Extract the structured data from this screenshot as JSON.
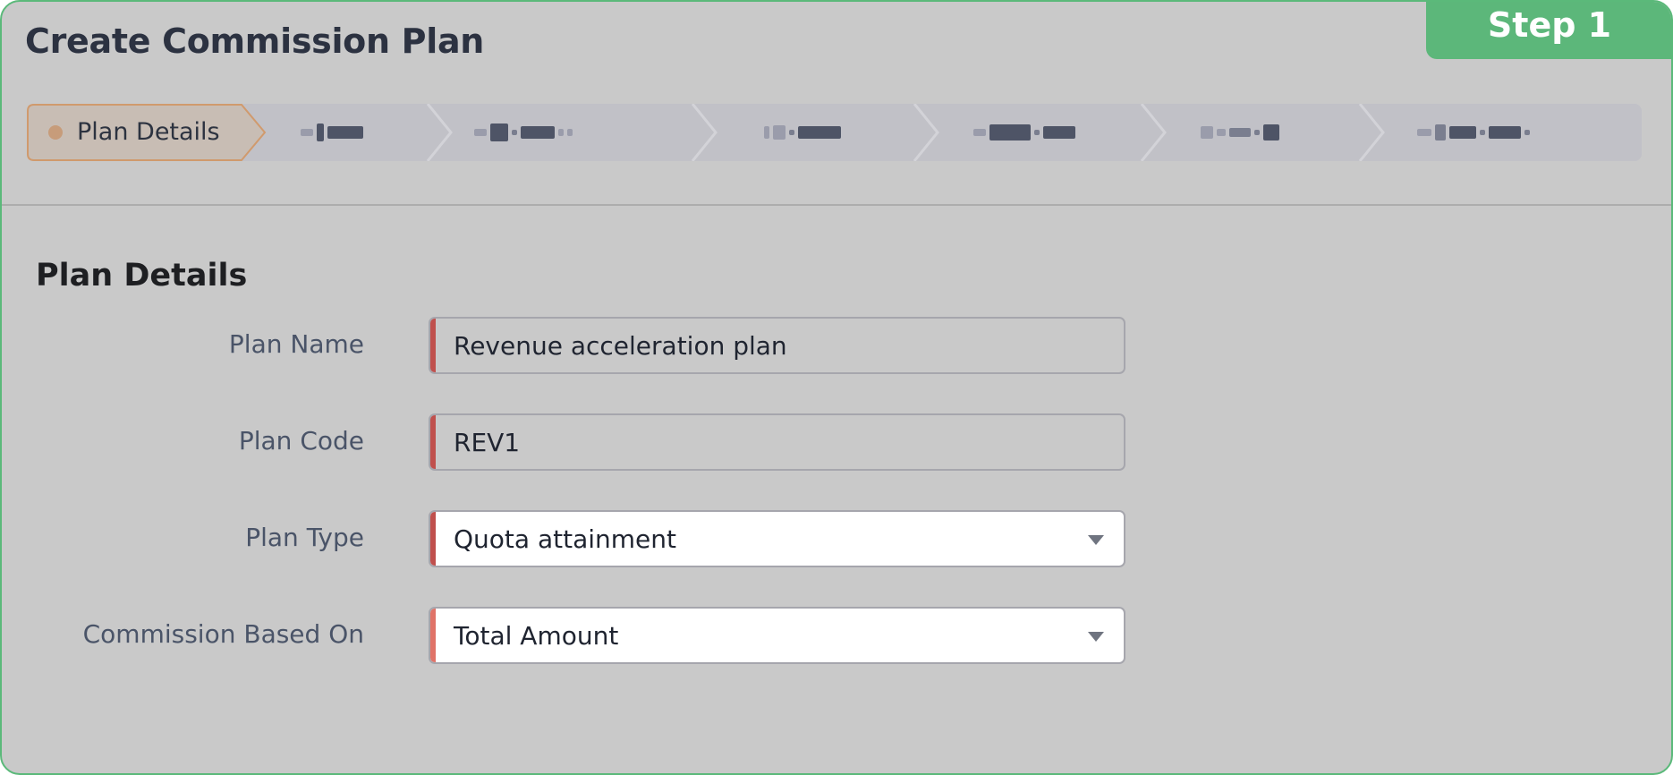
{
  "badge": {
    "label": "Step 1"
  },
  "header": {
    "title": "Create Commission Plan"
  },
  "stepper": {
    "active": {
      "label": "Plan Details"
    },
    "redacted_steps": 6
  },
  "section": {
    "title": "Plan Details"
  },
  "form": {
    "plan_name": {
      "label": "Plan Name",
      "value": "Revenue acceleration plan"
    },
    "plan_code": {
      "label": "Plan Code",
      "value": "REV1"
    },
    "plan_type": {
      "label": "Plan Type",
      "value": "Quota attainment"
    },
    "commission_based_on": {
      "label": "Commission Based On",
      "value": "Total Amount"
    }
  },
  "colors": {
    "accent_green": "#5cb77a",
    "required_marker": "#c0504d",
    "card_background": "#c9c9c9"
  }
}
